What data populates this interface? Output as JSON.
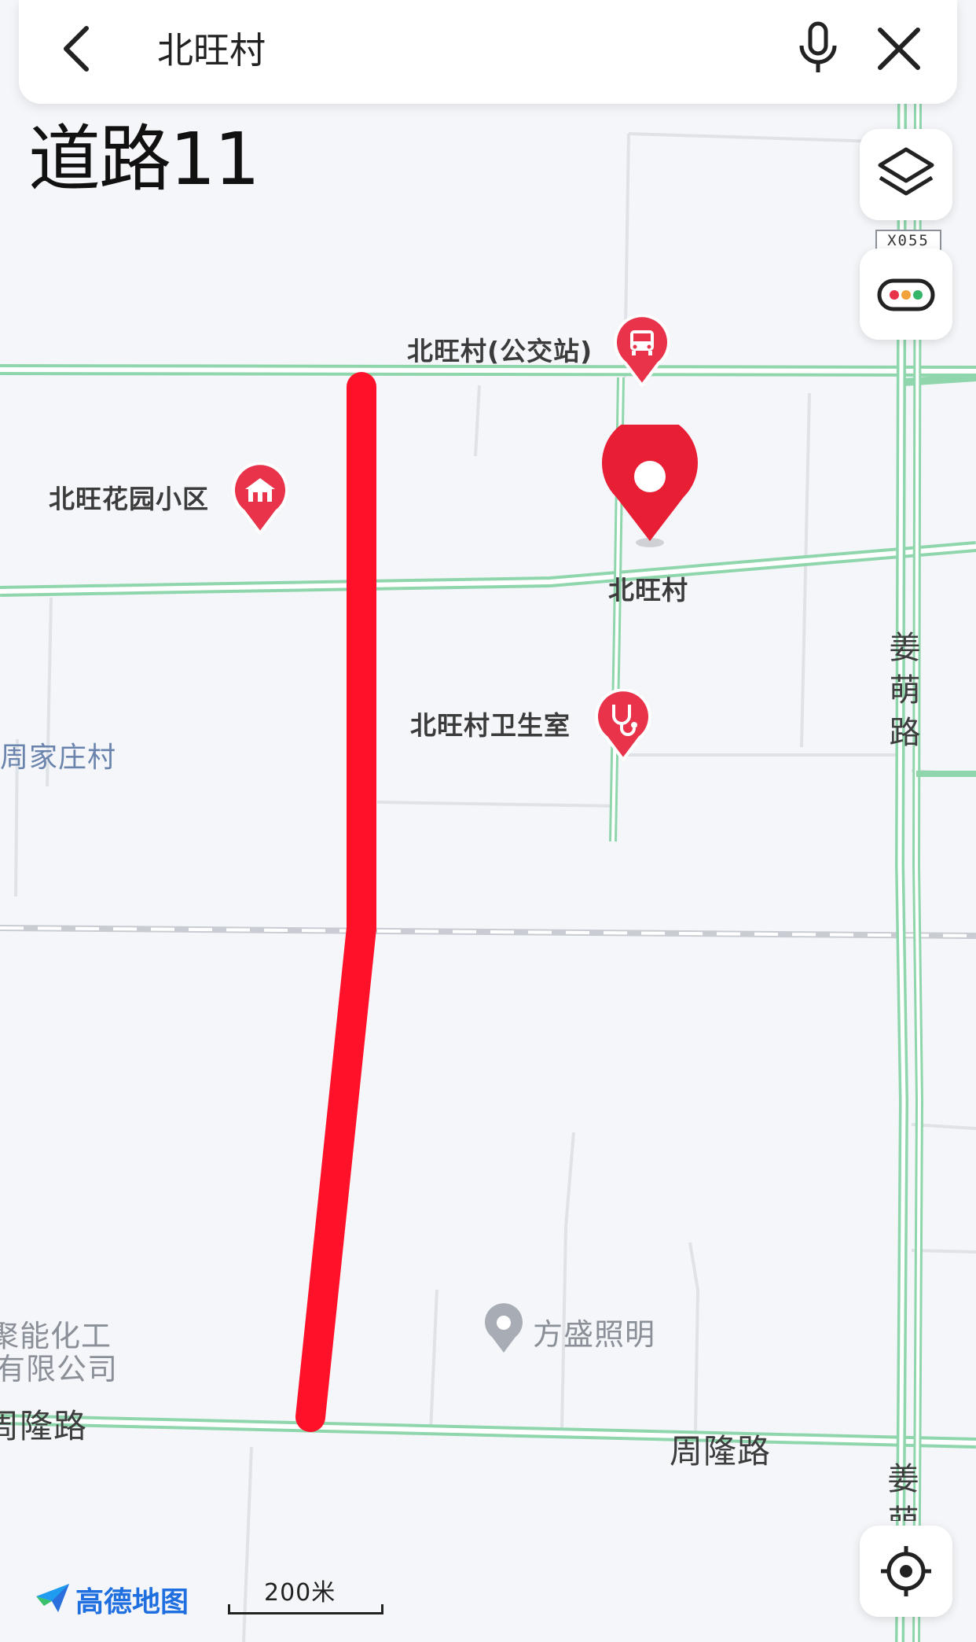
{
  "search": {
    "query": "北旺村"
  },
  "overlay": {
    "title": "道路11"
  },
  "map_controls": {
    "road_shield": "X055"
  },
  "places": {
    "bus_stop": "北旺村(公交站)",
    "garden": "北旺花园小区",
    "village_pin": "北旺村",
    "clinic": "北旺村卫生室",
    "zhoujia": "周家庄村",
    "fangsheng": "方盛照明",
    "chem_line1": "聚能化工",
    "chem_line2": "有限公司"
  },
  "roads": {
    "zhoulong_left": "周隆路",
    "zhoulong_right": "周隆路",
    "jiangmeng": "姜萌路",
    "jiangmeng_bottom": "姜萌"
  },
  "footer": {
    "brand": "高德地图",
    "scale": "200米"
  },
  "colors": {
    "road_green": "#8fd6ad",
    "highlight_route": "#ff1229",
    "poi_red": "#e8334a",
    "brand_blue": "#1f6fe0"
  }
}
